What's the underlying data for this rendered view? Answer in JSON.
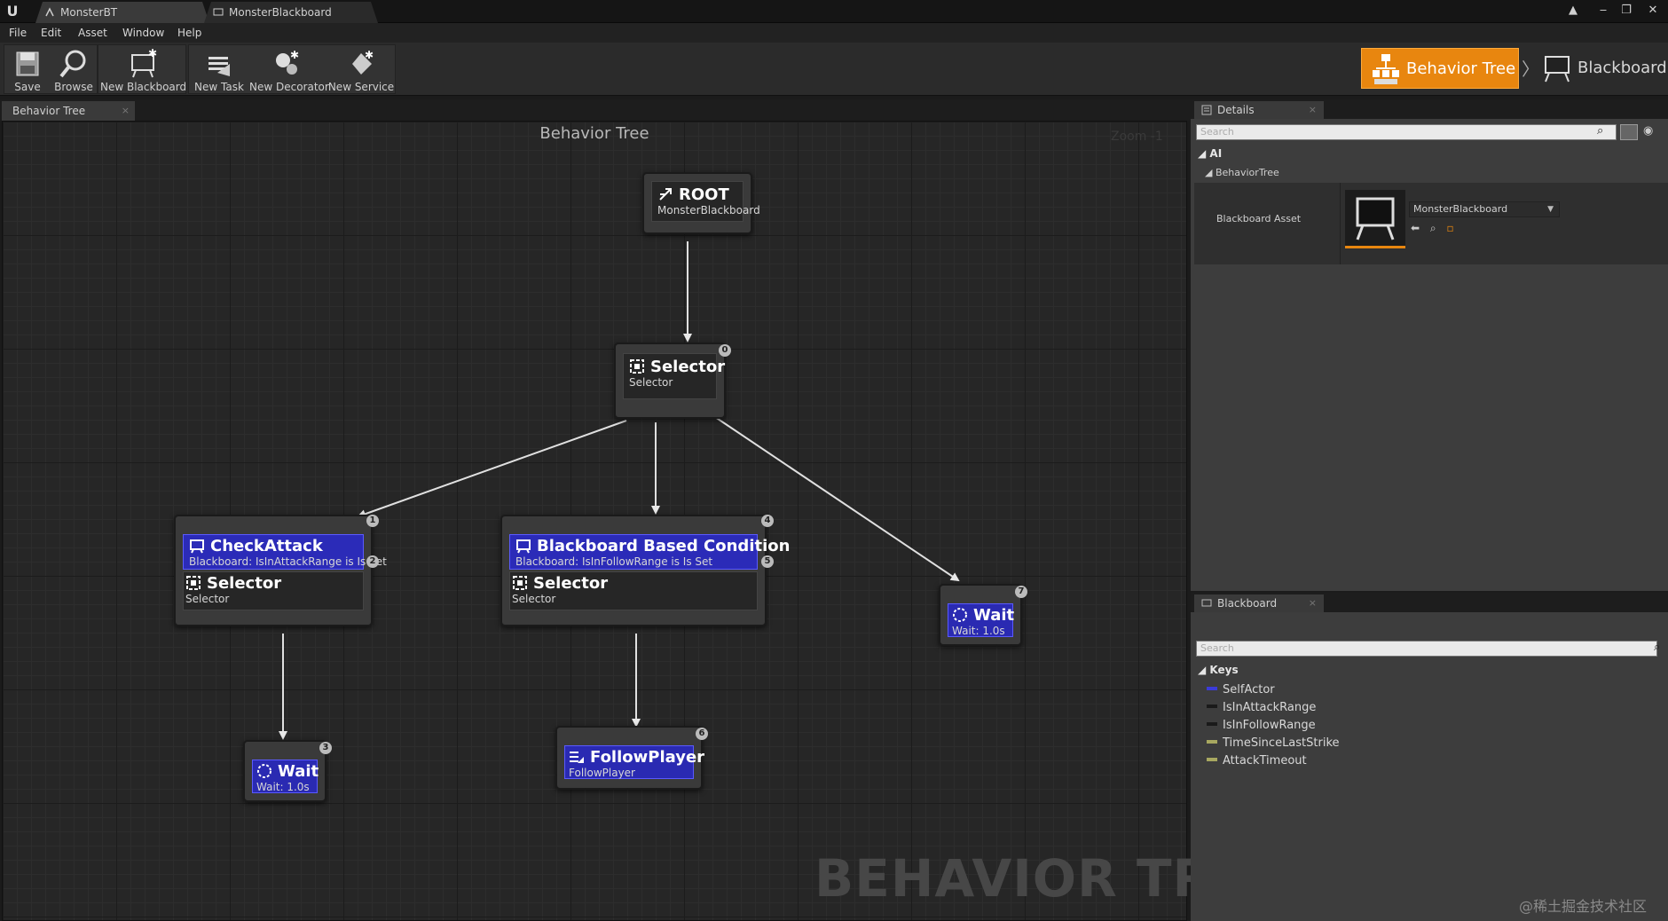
{
  "window": {
    "tabs": [
      {
        "label": "MonsterBT",
        "active": true
      },
      {
        "label": "MonsterBlackboard",
        "active": false
      }
    ],
    "controls": {
      "minimize": "‒",
      "maximize": "❐",
      "close": "✕"
    }
  },
  "menu": [
    "File",
    "Edit",
    "Asset",
    "Window",
    "Help"
  ],
  "toolbar": {
    "buttons": [
      {
        "label": "Save",
        "icon": "save-icon"
      },
      {
        "label": "Browse",
        "icon": "browse-icon"
      },
      {
        "label": "New Blackboard",
        "icon": "new-blackboard-icon"
      },
      {
        "label": "New Task",
        "icon": "new-task-icon"
      },
      {
        "label": "New Decorator",
        "icon": "new-decorator-icon"
      },
      {
        "label": "New Service",
        "icon": "new-service-icon"
      }
    ],
    "modes": {
      "behavior_tree": "Behavior Tree",
      "separator": "〉",
      "blackboard": "Blackboard"
    }
  },
  "graph": {
    "tab_label": "Behavior Tree",
    "tab_close": "×",
    "title": "Behavior Tree",
    "zoom": "Zoom -1",
    "watermark": "BEHAVIOR TREE",
    "colors": {
      "decorator": "#2b2bb8",
      "task": "#2a2ab2",
      "composite": "#262626",
      "accent": "#e8860f"
    },
    "nodes": {
      "root": {
        "title": "ROOT",
        "subtitle": "MonsterBlackboard"
      },
      "selector_main": {
        "title": "Selector",
        "subtitle": "Selector",
        "index": "0"
      },
      "left_branch": {
        "decorator_title": "CheckAttack",
        "decorator_sub": "Blackboard: IsInAttackRange is Is Set",
        "decorator_index": "2",
        "title": "Selector",
        "subtitle": "Selector",
        "index": "1"
      },
      "middle_branch": {
        "decorator_title": "Blackboard Based Condition",
        "decorator_sub": "Blackboard: IsInFollowRange is Is Set",
        "decorator_index": "5",
        "title": "Selector",
        "subtitle": "Selector",
        "index": "4"
      },
      "wait_left": {
        "title": "Wait",
        "subtitle": "Wait: 1.0s",
        "index": "3"
      },
      "follow_player": {
        "title": "FollowPlayer",
        "subtitle": "FollowPlayer",
        "index": "6"
      },
      "wait_right": {
        "title": "Wait",
        "subtitle": "Wait: 1.0s",
        "index": "7"
      }
    }
  },
  "details": {
    "tab_label": "Details",
    "tab_close": "×",
    "search_placeholder": "Search",
    "category": "AI",
    "subcategory": "BehaviorTree",
    "property_name": "Blackboard Asset",
    "property_value": "MonsterBlackboard"
  },
  "blackboard": {
    "tab_label": "Blackboard",
    "tab_close": "×",
    "search_placeholder": "Search",
    "keys_header": "Keys",
    "keys": [
      {
        "name": "SelfActor",
        "color": "#3b3bd8"
      },
      {
        "name": "IsInAttackRange",
        "color": "#1a1a1a"
      },
      {
        "name": "IsInFollowRange",
        "color": "#1a1a1a"
      },
      {
        "name": "TimeSinceLastStrike",
        "color": "#a8a860"
      },
      {
        "name": "AttackTimeout",
        "color": "#a8a860"
      }
    ]
  },
  "corner_watermark": "@稀土掘金技术社区"
}
